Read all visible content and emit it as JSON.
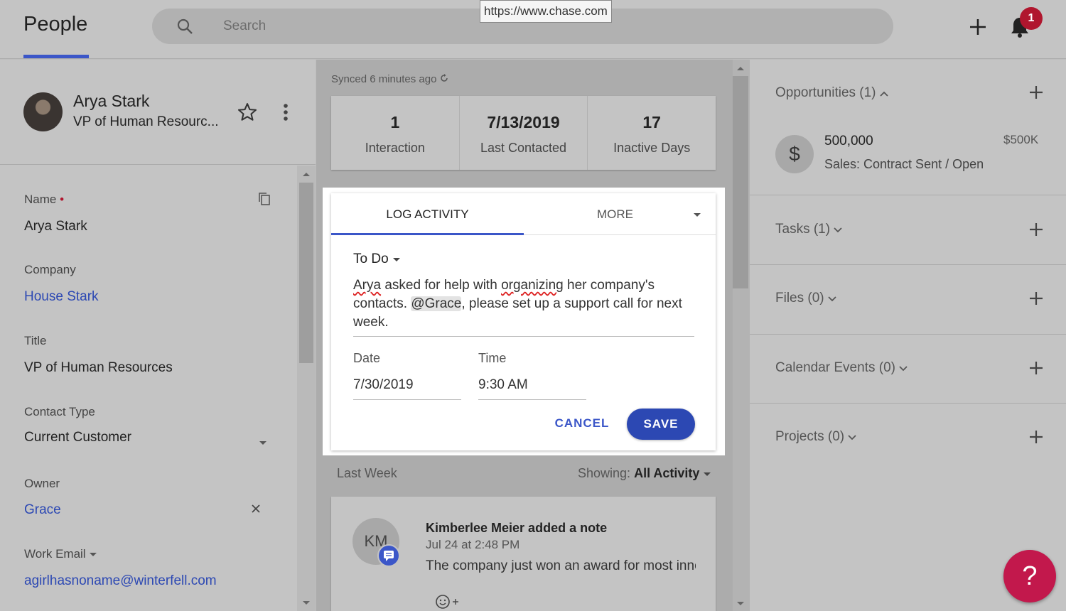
{
  "header": {
    "title": "People",
    "search_placeholder": "Search",
    "tooltip_url": "https://www.chase.com",
    "notification_count": "1"
  },
  "profile": {
    "name": "Arya Stark",
    "title_short": "VP of Human Resourc..."
  },
  "fields": {
    "name_label": "Name",
    "name_required": "•",
    "name_value": "Arya Stark",
    "company_label": "Company",
    "company_value": "House Stark",
    "title_label": "Title",
    "title_value": "VP of Human Resources",
    "contact_type_label": "Contact Type",
    "contact_type_value": "Current Customer",
    "owner_label": "Owner",
    "owner_value": "Grace",
    "work_email_label": "Work Email",
    "work_email_value": "agirlhasnoname@winterfell.com"
  },
  "middle": {
    "synced": "Synced 6 minutes ago",
    "stats": [
      {
        "value": "1",
        "label": "Interaction"
      },
      {
        "value": "7/13/2019",
        "label": "Last Contacted"
      },
      {
        "value": "17",
        "label": "Inactive Days"
      }
    ],
    "activity": {
      "tab_log": "LOG ACTIVITY",
      "tab_more": "MORE",
      "type": "To Do",
      "note_w1": "Arya",
      "note_t1": " asked for help with ",
      "note_w2": "organizing",
      "note_t2": " her company's contacts. ",
      "note_mention": "@Grace",
      "note_t3": ", please set up a support call for next week.",
      "date_label": "Date",
      "date_value": "7/30/2019",
      "time_label": "Time",
      "time_value": "9:30 AM",
      "cancel_label": "CANCEL",
      "save_label": "SAVE"
    },
    "last_week": "Last Week",
    "showing_prefix": "Showing:",
    "showing_value": "All Activity",
    "feed": {
      "initials": "KM",
      "title": "Kimberlee Meier added a note",
      "time": "Jul 24 at 2:48 PM",
      "body": "The company just won an award for most innovative"
    }
  },
  "right": {
    "opportunities_title": "Opportunities (1)",
    "opp_amount": "500,000",
    "opp_stage": "Sales: Contract Sent / Open",
    "opp_value": "$500K",
    "tasks_title": "Tasks (1)",
    "files_title": "Files (0)",
    "calendar_title": "Calendar Events (0)",
    "projects_title": "Projects (0)"
  },
  "help_label": "?"
}
